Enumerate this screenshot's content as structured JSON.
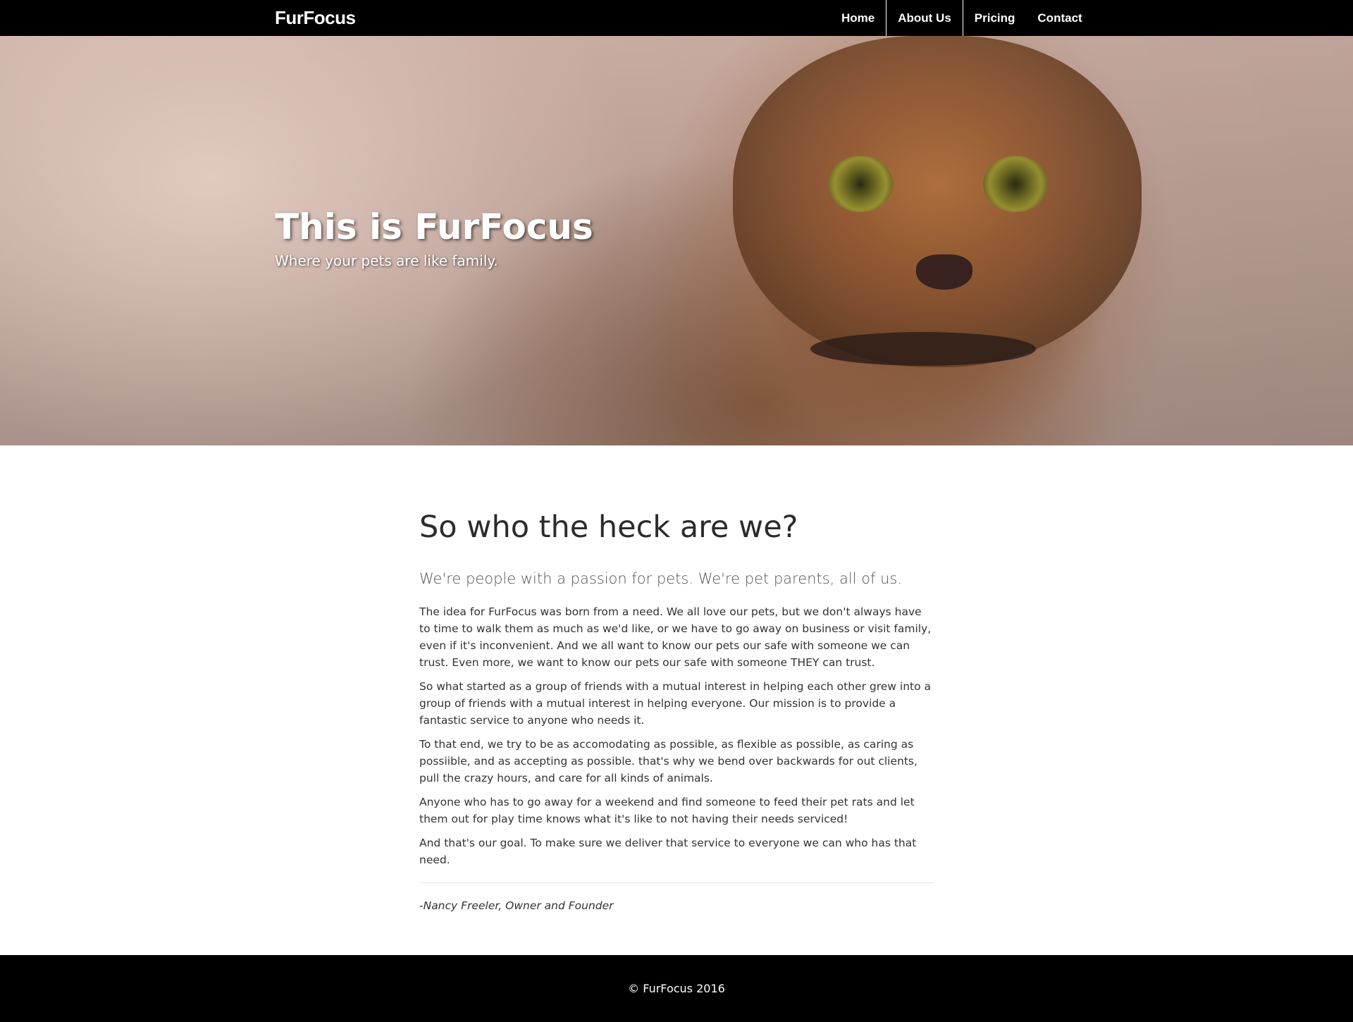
{
  "navbar": {
    "brand": "FurFocus",
    "items": [
      {
        "label": "Home",
        "active": false
      },
      {
        "label": "About Us",
        "active": true
      },
      {
        "label": "Pricing",
        "active": false
      },
      {
        "label": "Contact",
        "active": false
      }
    ]
  },
  "hero": {
    "title": "This is FurFocus",
    "subtitle": "Where your pets are like family."
  },
  "about": {
    "heading": "So who the heck are we?",
    "lead": "We're people with a passion for pets. We're pet parents, all of us.",
    "paragraphs": [
      "The idea for FurFocus was born from a need. We all love our pets, but we don't always have to time to walk them as much as we'd like, or we have to go away on business or visit family, even if it's inconvenient. And we all want to know our pets our safe with someone we can trust. Even more, we want to know our pets our safe with someone THEY can trust.",
      "So what started as a group of friends with a mutual interest in helping each other grew into a group of friends with a mutual interest in helping everyone. Our mission is to provide a fantastic service to anyone who needs it.",
      "To that end, we try to be as accomodating as possible, as flexible as possible, as caring as possiible, and as accepting as possible. that's why we bend over backwards for out clients, pull the crazy hours, and care for all kinds of animals.",
      "Anyone who has to go away for a weekend and find someone to feed their pet rats and let them out for play time knows what it's like to not having their needs serviced!",
      "And that's our goal. To make sure we deliver that service to everyone we can who has that need."
    ],
    "signature": "-Nancy Freeler, Owner and Founder"
  },
  "footer": {
    "copyright": "© FurFocus 2016"
  },
  "colors": {
    "navbar_bg": "#000000",
    "footer_bg": "#000000",
    "text_dark": "#333333",
    "nav_text": "#ffffff"
  }
}
